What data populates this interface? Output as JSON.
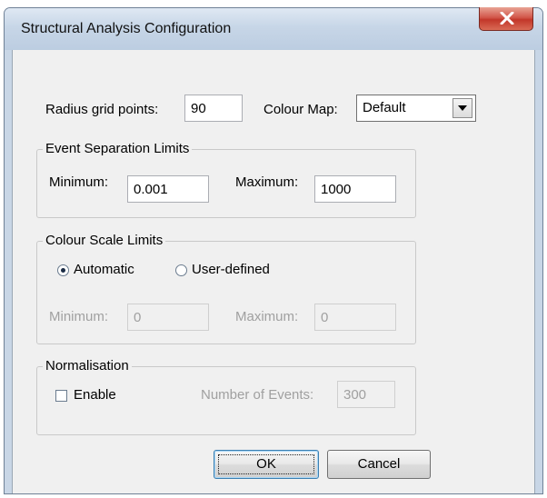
{
  "window": {
    "title": "Structural Analysis Configuration",
    "close_icon": "close-icon"
  },
  "radius": {
    "label": "Radius grid points:",
    "value": "90"
  },
  "colour_map": {
    "label": "Colour Map:",
    "selected": "Default"
  },
  "event_separation": {
    "title": "Event Separation Limits",
    "minimum_label": "Minimum:",
    "minimum_value": "0.001",
    "maximum_label": "Maximum:",
    "maximum_value": "1000"
  },
  "colour_scale": {
    "title": "Colour Scale Limits",
    "automatic_label": "Automatic",
    "automatic_selected": true,
    "user_defined_label": "User-defined",
    "user_defined_selected": false,
    "minimum_label": "Minimum:",
    "minimum_value": "0",
    "maximum_label": "Maximum:",
    "maximum_value": "0"
  },
  "normalisation": {
    "title": "Normalisation",
    "enable_label": "Enable",
    "enable_checked": false,
    "events_label": "Number of Events:",
    "events_value": "300"
  },
  "buttons": {
    "ok": "OK",
    "cancel": "Cancel"
  }
}
